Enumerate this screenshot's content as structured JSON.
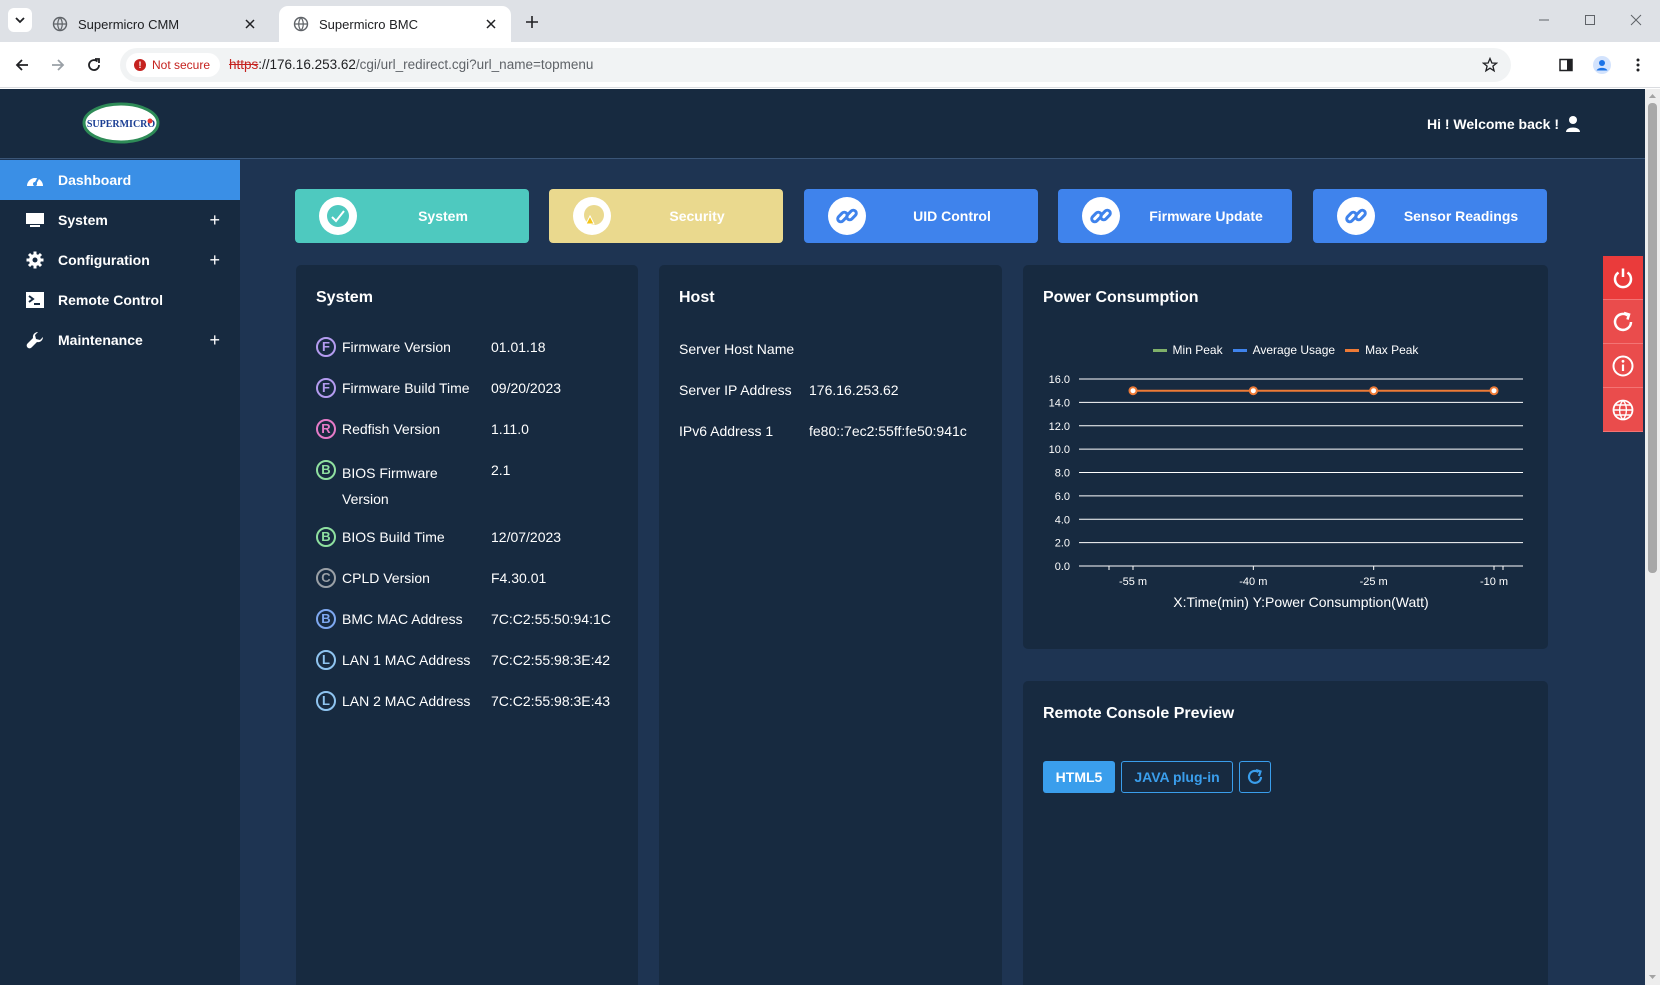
{
  "browser": {
    "tabs": [
      {
        "title": "Supermicro CMM",
        "active": false
      },
      {
        "title": "Supermicro BMC",
        "active": true
      }
    ],
    "security_chip": "Not secure",
    "url_scheme": "https",
    "url_host": "://176.16.253.62",
    "url_path": "/cgi/url_redirect.cgi?url_name=topmenu"
  },
  "header": {
    "logo_text": "SUPERMICRO",
    "welcome": "Hi ! Welcome back !"
  },
  "sidebar": {
    "items": [
      {
        "label": "Dashboard",
        "icon": "dashboard-icon",
        "expandable": false,
        "active": true
      },
      {
        "label": "System",
        "icon": "monitor-icon",
        "expandable": true,
        "active": false
      },
      {
        "label": "Configuration",
        "icon": "gear-icon",
        "expandable": true,
        "active": false
      },
      {
        "label": "Remote Control",
        "icon": "terminal-icon",
        "expandable": false,
        "active": false
      },
      {
        "label": "Maintenance",
        "icon": "wrench-icon",
        "expandable": true,
        "active": false
      }
    ],
    "plus": "+"
  },
  "quick_buttons": [
    {
      "label": "System",
      "icon": "check-icon",
      "color": "#4ec9bf"
    },
    {
      "label": "Security",
      "icon": "warning-icon",
      "color": "#ead98e"
    },
    {
      "label": "UID Control",
      "icon": "link-icon",
      "color": "#3f83ec"
    },
    {
      "label": "Firmware Update",
      "icon": "link-icon",
      "color": "#3f83ec"
    },
    {
      "label": "Sensor Readings",
      "icon": "link-icon",
      "color": "#3f83ec"
    }
  ],
  "system_card": {
    "title": "System",
    "rows": [
      {
        "letter": "F",
        "color": "#b49cf0",
        "label": "Firmware Version",
        "value": "01.01.18"
      },
      {
        "letter": "F",
        "color": "#b49cf0",
        "label": "Firmware Build Time",
        "value": "09/20/2023"
      },
      {
        "letter": "R",
        "color": "#e57bc8",
        "label": "Redfish Version",
        "value": "1.11.0"
      },
      {
        "letter": "B",
        "color": "#8fe0a0",
        "label": "BIOS Firmware Version",
        "value": "2.1"
      },
      {
        "letter": "B",
        "color": "#8fe0a0",
        "label": "BIOS Build Time",
        "value": "12/07/2023"
      },
      {
        "letter": "C",
        "color": "#9aa0a6",
        "label": "CPLD Version",
        "value": "F4.30.01"
      },
      {
        "letter": "B",
        "color": "#7ea8f0",
        "label": "BMC MAC Address",
        "value": "7C:C2:55:50:94:1C"
      },
      {
        "letter": "L",
        "color": "#8fc4f0",
        "label": "LAN 1 MAC Address",
        "value": "7C:C2:55:98:3E:42"
      },
      {
        "letter": "L",
        "color": "#8fc4f0",
        "label": "LAN 2 MAC Address",
        "value": "7C:C2:55:98:3E:43"
      }
    ]
  },
  "host_card": {
    "title": "Host",
    "rows": [
      {
        "label": "Server Host Name",
        "value": ""
      },
      {
        "label": "Server IP Address",
        "value": "176.16.253.62"
      },
      {
        "label": "IPv6 Address 1",
        "value": "fe80::7ec2:55ff:fe50:941c"
      }
    ]
  },
  "power_card": {
    "title": "Power Consumption"
  },
  "chart_data": {
    "type": "line",
    "categories": [
      "-55 m",
      "-40 m",
      "-25 m",
      "-10 m"
    ],
    "series": [
      {
        "name": "Min Peak",
        "color": "#7fb069",
        "values": []
      },
      {
        "name": "Average Usage",
        "color": "#3f83ec",
        "values": []
      },
      {
        "name": "Max Peak",
        "color": "#ee7a36",
        "values": [
          15,
          15,
          15,
          15
        ]
      }
    ],
    "yticks": [
      "16.0",
      "14.0",
      "12.0",
      "10.0",
      "8.0",
      "6.0",
      "4.0",
      "2.0",
      "0.0"
    ],
    "ylim": [
      0,
      16
    ],
    "xlabel": "X:Time(min) Y:Power Consumption(Watt)",
    "legend_position": "top",
    "grid": true
  },
  "console_card": {
    "title": "Remote Console Preview",
    "html5_label": "HTML5",
    "java_label": "JAVA plug-in"
  },
  "side_panel": {
    "buttons": [
      "power-icon",
      "reset-icon",
      "info-icon",
      "globe-icon"
    ]
  }
}
